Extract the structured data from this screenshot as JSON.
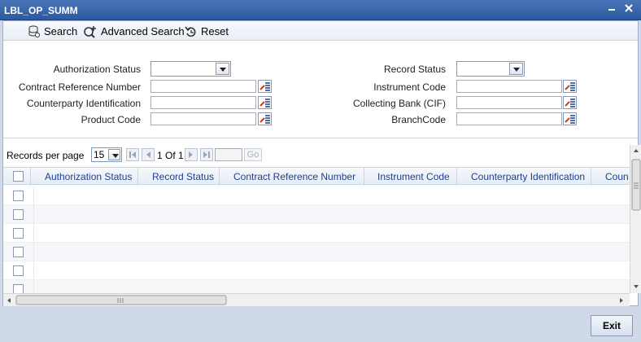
{
  "window": {
    "title": "LBL_OP_SUMM",
    "minimize_icon": "minimize-icon",
    "close_icon": "close-icon"
  },
  "toolbar": {
    "search_label": "Search",
    "advanced_search_label": "Advanced Search",
    "reset_label": "Reset"
  },
  "form": {
    "authorization_status": "Authorization Status",
    "contract_reference_number": "Contract Reference Number",
    "counterparty_identification": "Counterparty Identification",
    "product_code": "Product Code",
    "record_status": "Record Status",
    "instrument_code": "Instrument Code",
    "collecting_bank": "Collecting Bank (CIF)",
    "branch_code": "BranchCode"
  },
  "pager": {
    "records_per_page_label": "Records per page",
    "records_per_page_value": "15",
    "page_info": "1 Of 1",
    "go_label": "Go"
  },
  "grid": {
    "columns": [
      "Authorization Status",
      "Record Status",
      "Contract Reference Number",
      "Instrument Code",
      "Counterparty Identification",
      "Coun"
    ],
    "row_count": 6
  },
  "footer": {
    "exit_label": "Exit"
  },
  "colors": {
    "titlebar": "#2c5aa0",
    "header_text": "#1f3f8f",
    "frame": "#cfd9ea"
  }
}
